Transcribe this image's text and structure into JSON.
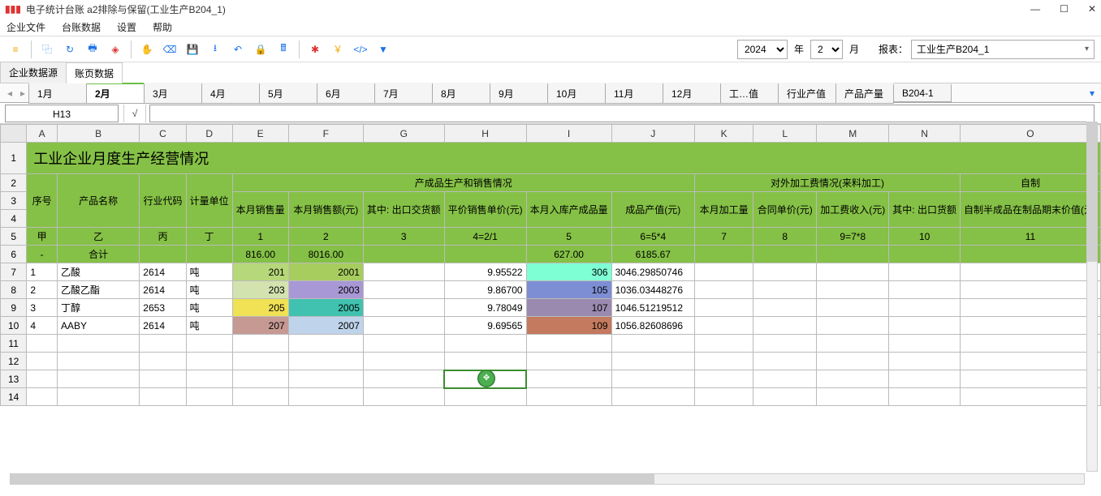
{
  "window": {
    "title": "电子统计台账  a2排除与保留(工业生产B204_1)"
  },
  "menus": [
    "企业文件",
    "台账数据",
    "设置",
    "帮助"
  ],
  "toolbar": {
    "year": "2024",
    "year_label": "年",
    "month": "2",
    "month_label": "月",
    "report_label": "报表：",
    "report_value": "工业生产B204_1"
  },
  "top_tabs": {
    "items": [
      "企业数据源",
      "账页数据"
    ],
    "active": 1
  },
  "sheet_tabs": {
    "items": [
      "1月",
      "2月",
      "3月",
      "4月",
      "5月",
      "6月",
      "7月",
      "8月",
      "9月",
      "10月",
      "11月",
      "12月",
      "工…值",
      "行业产值",
      "产品产量",
      "B204-1"
    ],
    "active": 1
  },
  "cell_ref": "H13",
  "columns": [
    "A",
    "B",
    "C",
    "D",
    "E",
    "F",
    "G",
    "H",
    "I",
    "J",
    "K",
    "L",
    "M",
    "N",
    "O"
  ],
  "row_nums": [
    "1",
    "2",
    "3",
    "4",
    "5",
    "6",
    "7",
    "8",
    "9",
    "10",
    "11",
    "12",
    "13",
    "14"
  ],
  "sheet": {
    "title": "工业企业月度生产经营情况",
    "group1": "产成品生产和销售情况",
    "group2": "对外加工费情况(来料加工)",
    "group3": "自制",
    "h_seq": "序号",
    "h_name": "产品名称",
    "h_ind": "行业代码",
    "h_unit": "计量单位",
    "h_qty": "本月销售量",
    "h_amt": "本月销售额(元)",
    "h_exp": "其中: 出口交货额",
    "h_price": "平价销售单价(元)",
    "h_stock": "本月入库产成品量",
    "h_prod": "成品产值(元)",
    "h_proc": "本月加工量",
    "h_cprice": "合同单价(元)",
    "h_pinc": "加工费收入(元)",
    "h_pexp": "其中: 出口货额",
    "h_self": "自制半成品在制品期末价值(元)",
    "r5": {
      "a": "甲",
      "b": "乙",
      "c": "丙",
      "d": "丁",
      "e": "1",
      "f": "2",
      "g": "3",
      "h": "4=2/1",
      "i": "5",
      "j": "6=5*4",
      "k": "7",
      "l": "8",
      "m": "9=7*8",
      "n": "10",
      "o": "11"
    },
    "r6": {
      "a": "-",
      "b": "合计",
      "e": "816.00",
      "f": "8016.00",
      "i": "627.00",
      "j": "6185.67"
    },
    "rows": [
      {
        "a": "1",
        "b": "乙酸",
        "c": "2614",
        "d": "吨",
        "e": "201",
        "f": "2001",
        "h": "9.95522",
        "i": "306",
        "j": "3046.29850746"
      },
      {
        "a": "2",
        "b": "乙酸乙酯",
        "c": "2614",
        "d": "吨",
        "e": "203",
        "f": "2003",
        "h": "9.86700",
        "i": "105",
        "j": "1036.03448276"
      },
      {
        "a": "3",
        "b": "丁醇",
        "c": "2653",
        "d": "吨",
        "e": "205",
        "f": "2005",
        "h": "9.78049",
        "i": "107",
        "j": "1046.51219512"
      },
      {
        "a": "4",
        "b": "AABY",
        "c": "2614",
        "d": "吨",
        "e": "207",
        "f": "2007",
        "h": "9.69565",
        "i": "109",
        "j": "1056.82608696"
      }
    ]
  }
}
